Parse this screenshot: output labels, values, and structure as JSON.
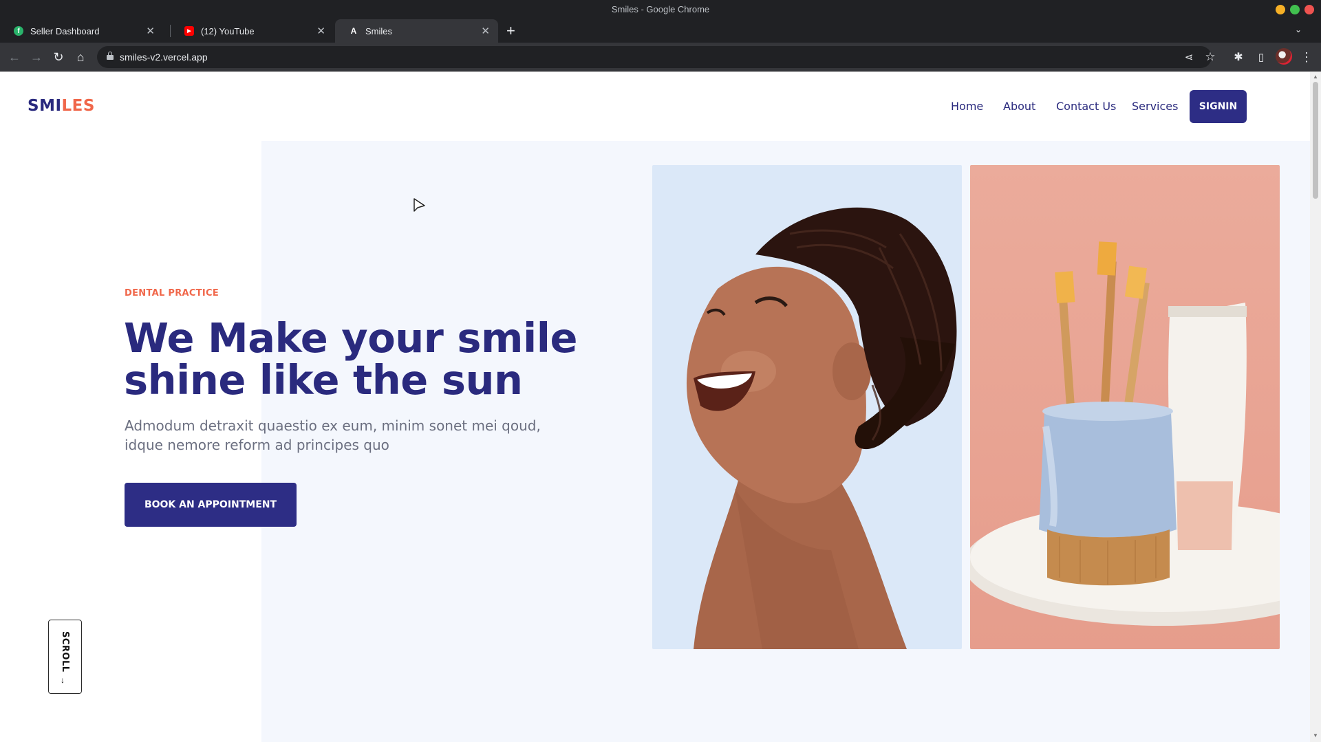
{
  "window": {
    "title": "Smiles - Google Chrome",
    "controls": {
      "minimize_color": "#f6b026",
      "maximize_color": "#41c04f",
      "close_color": "#ef5350"
    }
  },
  "tabs": [
    {
      "label": "Seller Dashboard",
      "favicon": "seller-dashboard-icon",
      "favicon_color": "#2ab36b",
      "active": false
    },
    {
      "label": "(12) YouTube",
      "favicon": "youtube-icon",
      "favicon_color": "#ff0000",
      "active": false
    },
    {
      "label": "Smiles",
      "favicon": "vercel-icon",
      "favicon_color": "#ffffff",
      "active": true
    }
  ],
  "toolbar": {
    "url": "smiles-v2.vercel.app"
  },
  "site": {
    "logo_part1": "SMI",
    "logo_part2": "LES",
    "colors": {
      "primary": "#2a2a7e",
      "accent": "#f0674a",
      "button": "#2d2d85",
      "hero_bg": "#f4f7fd"
    },
    "nav": {
      "home": "Home",
      "about": "About",
      "contact": "Contact Us",
      "services": "Services",
      "signin": "SIGNIN"
    },
    "hero": {
      "eyebrow": "DENTAL PRACTICE",
      "headline_line1": "We Make your smile",
      "headline_line2": "shine like the sun",
      "subtext": "Admodum detraxit quaestio ex eum, minim sonet mei qoud, idque nemore reform ad principes quo",
      "cta": "BOOK AN APPOINTMENT"
    },
    "scroll_indicator": "SCROLL"
  }
}
